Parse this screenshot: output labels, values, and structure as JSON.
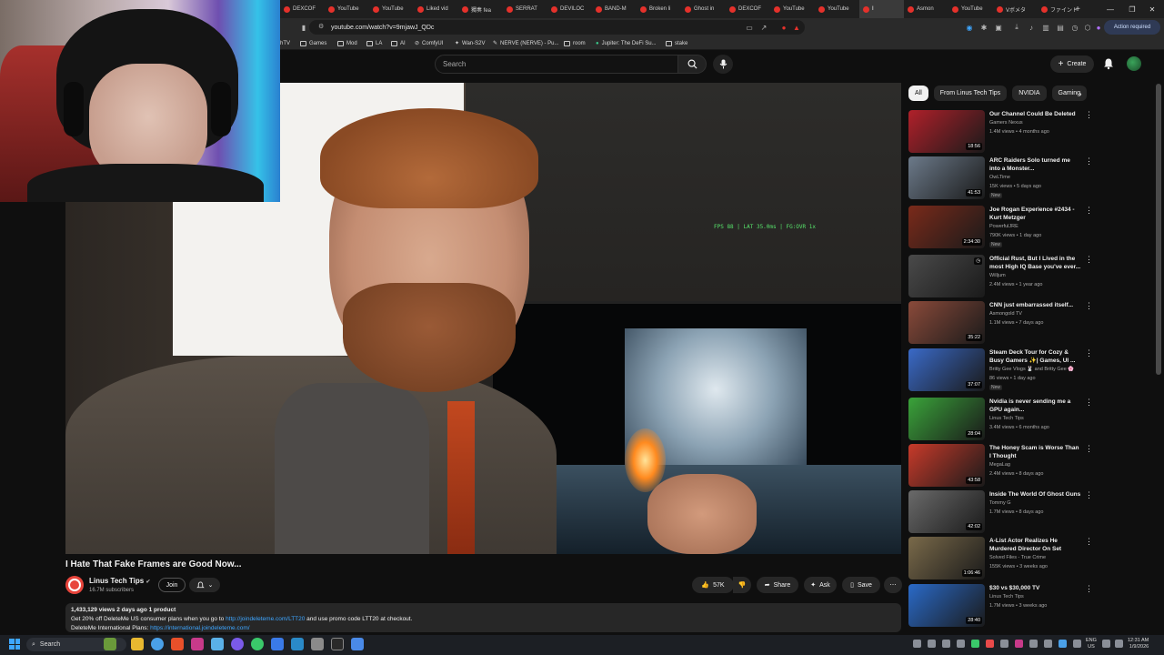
{
  "browser": {
    "tabs": [
      {
        "label": "DEXCOF"
      },
      {
        "label": "YouTube"
      },
      {
        "label": "YouTube"
      },
      {
        "label": "Liked vid"
      },
      {
        "label": "獨奏 fea"
      },
      {
        "label": "SERRAT"
      },
      {
        "label": "DEVILOC"
      },
      {
        "label": "BAND-M"
      },
      {
        "label": "Broken li"
      },
      {
        "label": "Ghost in"
      },
      {
        "label": "DEXCOF"
      },
      {
        "label": "YouTube"
      },
      {
        "label": "YouTube"
      },
      {
        "label": "I"
      },
      {
        "label": "Asmon"
      },
      {
        "label": "YouTube"
      },
      {
        "label": "Vボメタ"
      },
      {
        "label": "ファイント"
      }
    ],
    "url": "youtube.com/watch?v=9mjawJ_QDc",
    "action_required": "Action required",
    "bookmarks": [
      "hTV",
      "Games",
      "Mod",
      "LA",
      "AI",
      "ComfyUI",
      "Wan-S2V",
      "NERVE (NERVE) - Pu...",
      "room",
      "Jupiter: The DeFi Su...",
      "stake"
    ]
  },
  "youtube": {
    "search_placeholder": "Search",
    "create_label": "Create",
    "fps_overlay": "FPS 88 | LAT 35.0ms | FG:OVR 1x"
  },
  "video": {
    "title": "I Hate That Fake Frames are Good Now...",
    "channel": "Linus Tech Tips",
    "subscribers": "16.7M subscribers",
    "join_label": "Join",
    "likes": "57K",
    "share_label": "Share",
    "ask_label": "Ask",
    "save_label": "Save",
    "desc_stats": "1,433,129 views  2 days ago  1 product",
    "desc_line1_pre": "Get 20% off DeleteMe US consumer plans when you go to ",
    "desc_line1_link": "http://joindeleteme.com/LTT20",
    "desc_line1_post": " and use promo code LTT20 at checkout.",
    "desc_line2_pre": "DeleteMe International Plans: ",
    "desc_line2_link": "https://international.joindeleteme.com/"
  },
  "chips": [
    "All",
    "From Linus Tech Tips",
    "NVIDIA",
    "Gaming"
  ],
  "recommendations": [
    {
      "title": "Our Channel Could Be Deleted",
      "channel": "Gamers Nexus",
      "meta": "1.4M views • 4 months ago",
      "duration": "18:56",
      "badge": "",
      "color": "#b0202a"
    },
    {
      "title": "ARC Raiders Solo turned me into a Monster...",
      "channel": "OwLTime",
      "meta": "15K views • 5 days ago",
      "duration": "41:53",
      "badge": "New",
      "color": "#6c7a8a"
    },
    {
      "title": "Joe Rogan Experience #2434 - Kurt Metzger",
      "channel": "PowerfulJRE",
      "meta": "790K views • 1 day ago",
      "duration": "2:34:30",
      "badge": "New",
      "color": "#7a2a1a"
    },
    {
      "title": "Official Rust, But I Lived in the most High IQ Base you've ever...",
      "channel": "Willjum",
      "meta": "2.4M views • 1 year ago",
      "duration": "",
      "badge": "",
      "color": "#4a4a4a"
    },
    {
      "title": "CNN just embarrassed itself...",
      "channel": "Asmongold TV",
      "meta": "1.1M views • 7 days ago",
      "duration": "35:22",
      "badge": "",
      "color": "#8a4a3a"
    },
    {
      "title": "Steam Deck Tour for Cozy & Busy Gamers ✨| Games, UI ...",
      "channel": "Britty Gee Vlogs 🐰 and Britty Gee 🌸",
      "meta": "86 views • 1 day ago",
      "duration": "37:07",
      "badge": "New",
      "color": "#3a6ac8"
    },
    {
      "title": "Nvidia is never sending me a GPU again...",
      "channel": "Linus Tech Tips",
      "meta": "3.4M views • 6 months ago",
      "duration": "28:04",
      "badge": "",
      "color": "#3aa33a"
    },
    {
      "title": "The Honey Scam is Worse Than I Thought",
      "channel": "MegaLag",
      "meta": "2.4M views • 8 days ago",
      "duration": "43:58",
      "badge": "",
      "color": "#c83a2a"
    },
    {
      "title": "Inside The World Of Ghost Guns",
      "channel": "Tommy G",
      "meta": "1.7M views • 8 days ago",
      "duration": "42:02",
      "badge": "",
      "color": "#6a6a6a"
    },
    {
      "title": "A-List Actor Realizes He Murdered Director On Set",
      "channel": "Solved Files - True Crime",
      "meta": "155K views • 3 weeks ago",
      "duration": "1:06:46",
      "badge": "",
      "color": "#7a6a4a"
    },
    {
      "title": "$30 vs $30,000 TV",
      "channel": "Linus Tech Tips",
      "meta": "1.7M views • 3 weeks ago",
      "duration": "28:40",
      "badge": "",
      "color": "#2a6ac8"
    }
  ],
  "taskbar": {
    "search_label": "Search",
    "lang_line1": "ENG",
    "lang_line2": "US",
    "time": "12:31 AM",
    "date": "1/9/2026"
  }
}
